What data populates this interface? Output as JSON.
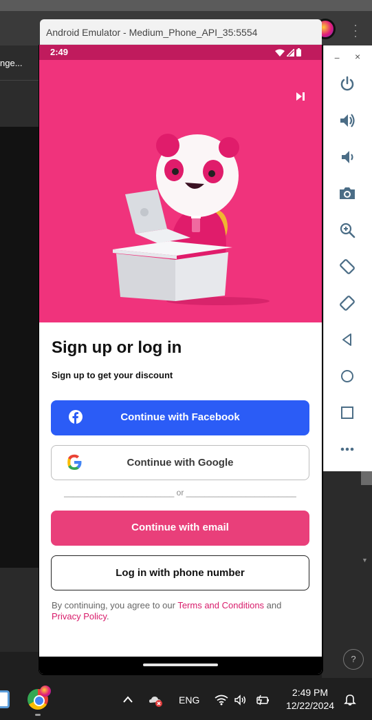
{
  "desktop": {
    "left_panel_text": "nge...",
    "help_label": "?"
  },
  "emulator": {
    "title": "Android Emulator - Medium_Phone_API_35:5554",
    "window_controls": {
      "minimize": "−",
      "close": "×"
    },
    "toolbar_icons": [
      "power-icon",
      "volume-up-icon",
      "volume-down-icon",
      "camera-icon",
      "zoom-icon",
      "rotate-left-icon",
      "rotate-right-icon",
      "back-icon",
      "home-icon",
      "overview-icon",
      "more-icon"
    ]
  },
  "status_bar": {
    "time": "2:49"
  },
  "app": {
    "hero_color": "#f0337c",
    "heading": "Sign up or log in",
    "subheading": "Sign up to get your discount",
    "buttons": {
      "facebook": "Continue with Facebook",
      "google": "Continue with Google",
      "email": "Continue with email",
      "phone": "Log in with phone number"
    },
    "divider": "________________________ or ________________________",
    "legal": {
      "prefix": "By continuing, you agree to our ",
      "terms": "Terms and Conditions",
      "middle": " and ",
      "privacy": "Privacy Policy",
      "suffix": "."
    },
    "colors": {
      "facebook": "#2b5cf6",
      "email": "#e93f7a",
      "link": "#d81b6a",
      "status_bar": "#c01b5d"
    }
  },
  "taskbar": {
    "language": "ENG",
    "time": "2:49 PM",
    "date": "12/22/2024"
  }
}
